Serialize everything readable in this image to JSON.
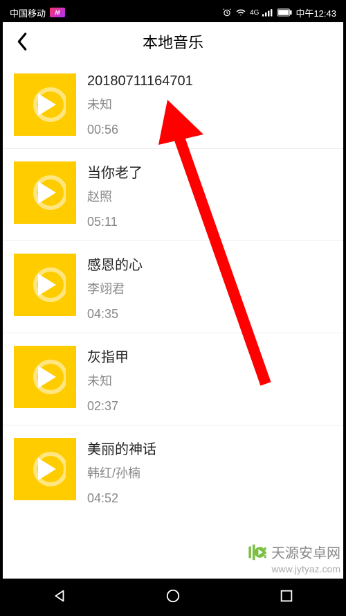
{
  "statusbar": {
    "carrier": "中国移动",
    "network": "4G",
    "time": "中午12:43"
  },
  "header": {
    "title": "本地音乐"
  },
  "songs": [
    {
      "title": "20180711164701",
      "artist": "未知",
      "duration": "00:56"
    },
    {
      "title": "当你老了",
      "artist": "赵照",
      "duration": "05:11"
    },
    {
      "title": "感恩的心",
      "artist": "李翊君",
      "duration": "04:35"
    },
    {
      "title": "灰指甲",
      "artist": "未知",
      "duration": "02:37"
    },
    {
      "title": "美丽的神话",
      "artist": "韩红/孙楠",
      "duration": "04:52"
    }
  ],
  "watermark": {
    "text": "天源安卓网",
    "url": "www.jytyaz.com"
  }
}
